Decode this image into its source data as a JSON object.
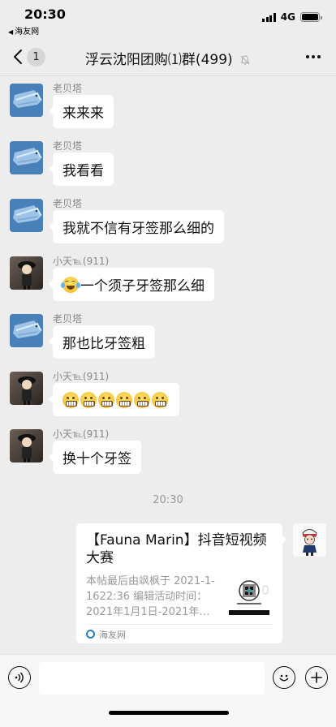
{
  "status_bar": {
    "time": "20:30",
    "back_app": "海友网",
    "network": "4G"
  },
  "nav": {
    "unread_count": "1",
    "title": "浮云沈阳团购⑴群(499)"
  },
  "messages": [
    {
      "sender": "老贝塔",
      "text": "来来来"
    },
    {
      "sender": "老贝塔",
      "text": "我看看"
    },
    {
      "sender": "老贝塔",
      "text": "我就不信有牙签那么细的"
    },
    {
      "sender": "小天℡(911)",
      "text": "一个须子牙签那么细",
      "emoji": "tears-of-joy"
    },
    {
      "sender": "老贝塔",
      "text": "那也比牙签粗"
    },
    {
      "sender": "小天℡(911)",
      "text": "",
      "emoji": "grimacing",
      "emoji_count": 6
    },
    {
      "sender": "小天℡(911)",
      "text": "换十个牙签"
    }
  ],
  "time_separator": "20:30",
  "link_card": {
    "title": "【Fauna Marin】抖音短视频大赛",
    "description": "本帖最后由飒枫于 2021-1-1622:36 编辑活动时间：2021年1月1日-2021年…",
    "source": "海友网"
  },
  "input_bar": {
    "placeholder": ""
  },
  "colors": {
    "background": "#ededed",
    "bubble": "#ffffff",
    "meta_text": "#888888"
  }
}
